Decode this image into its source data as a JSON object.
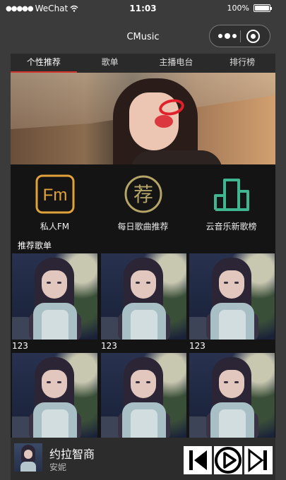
{
  "status_bar": {
    "carrier": "WeChat",
    "time": "11:03",
    "battery": "100%",
    "battery_level": 1.0
  },
  "nav": {
    "title": "CMusic",
    "capsule_icons": [
      "more-icon",
      "close-target-icon"
    ]
  },
  "tabs": [
    {
      "label": "个性推荐",
      "active": true
    },
    {
      "label": "歌单",
      "active": false
    },
    {
      "label": "主播电台",
      "active": false
    },
    {
      "label": "排行榜",
      "active": false
    }
  ],
  "banner": {
    "icon": "banner-image"
  },
  "quick_links": [
    {
      "label": "私人FM",
      "icon": "fm-icon",
      "icon_text": "Fm",
      "color": "#e2a23a"
    },
    {
      "label": "每日歌曲推荐",
      "icon": "daily-recommend-icon",
      "icon_text": "荐",
      "color": "#b5a567"
    },
    {
      "label": "云音乐新歌榜",
      "icon": "chart-bars-icon",
      "icon_text": "",
      "color": "#3fb68f"
    }
  ],
  "section": {
    "title": "推荐歌单"
  },
  "playlists": [
    {
      "name": "123"
    },
    {
      "name": "123"
    },
    {
      "name": "123"
    },
    {
      "name": ""
    },
    {
      "name": ""
    },
    {
      "name": ""
    }
  ],
  "player": {
    "title": "约拉智商",
    "artist": "安妮",
    "controls": [
      "previous-icon",
      "play-icon",
      "next-icon"
    ]
  },
  "colors": {
    "accent": "#d0332b",
    "background": "#3b3b3b",
    "content": "#141414"
  }
}
